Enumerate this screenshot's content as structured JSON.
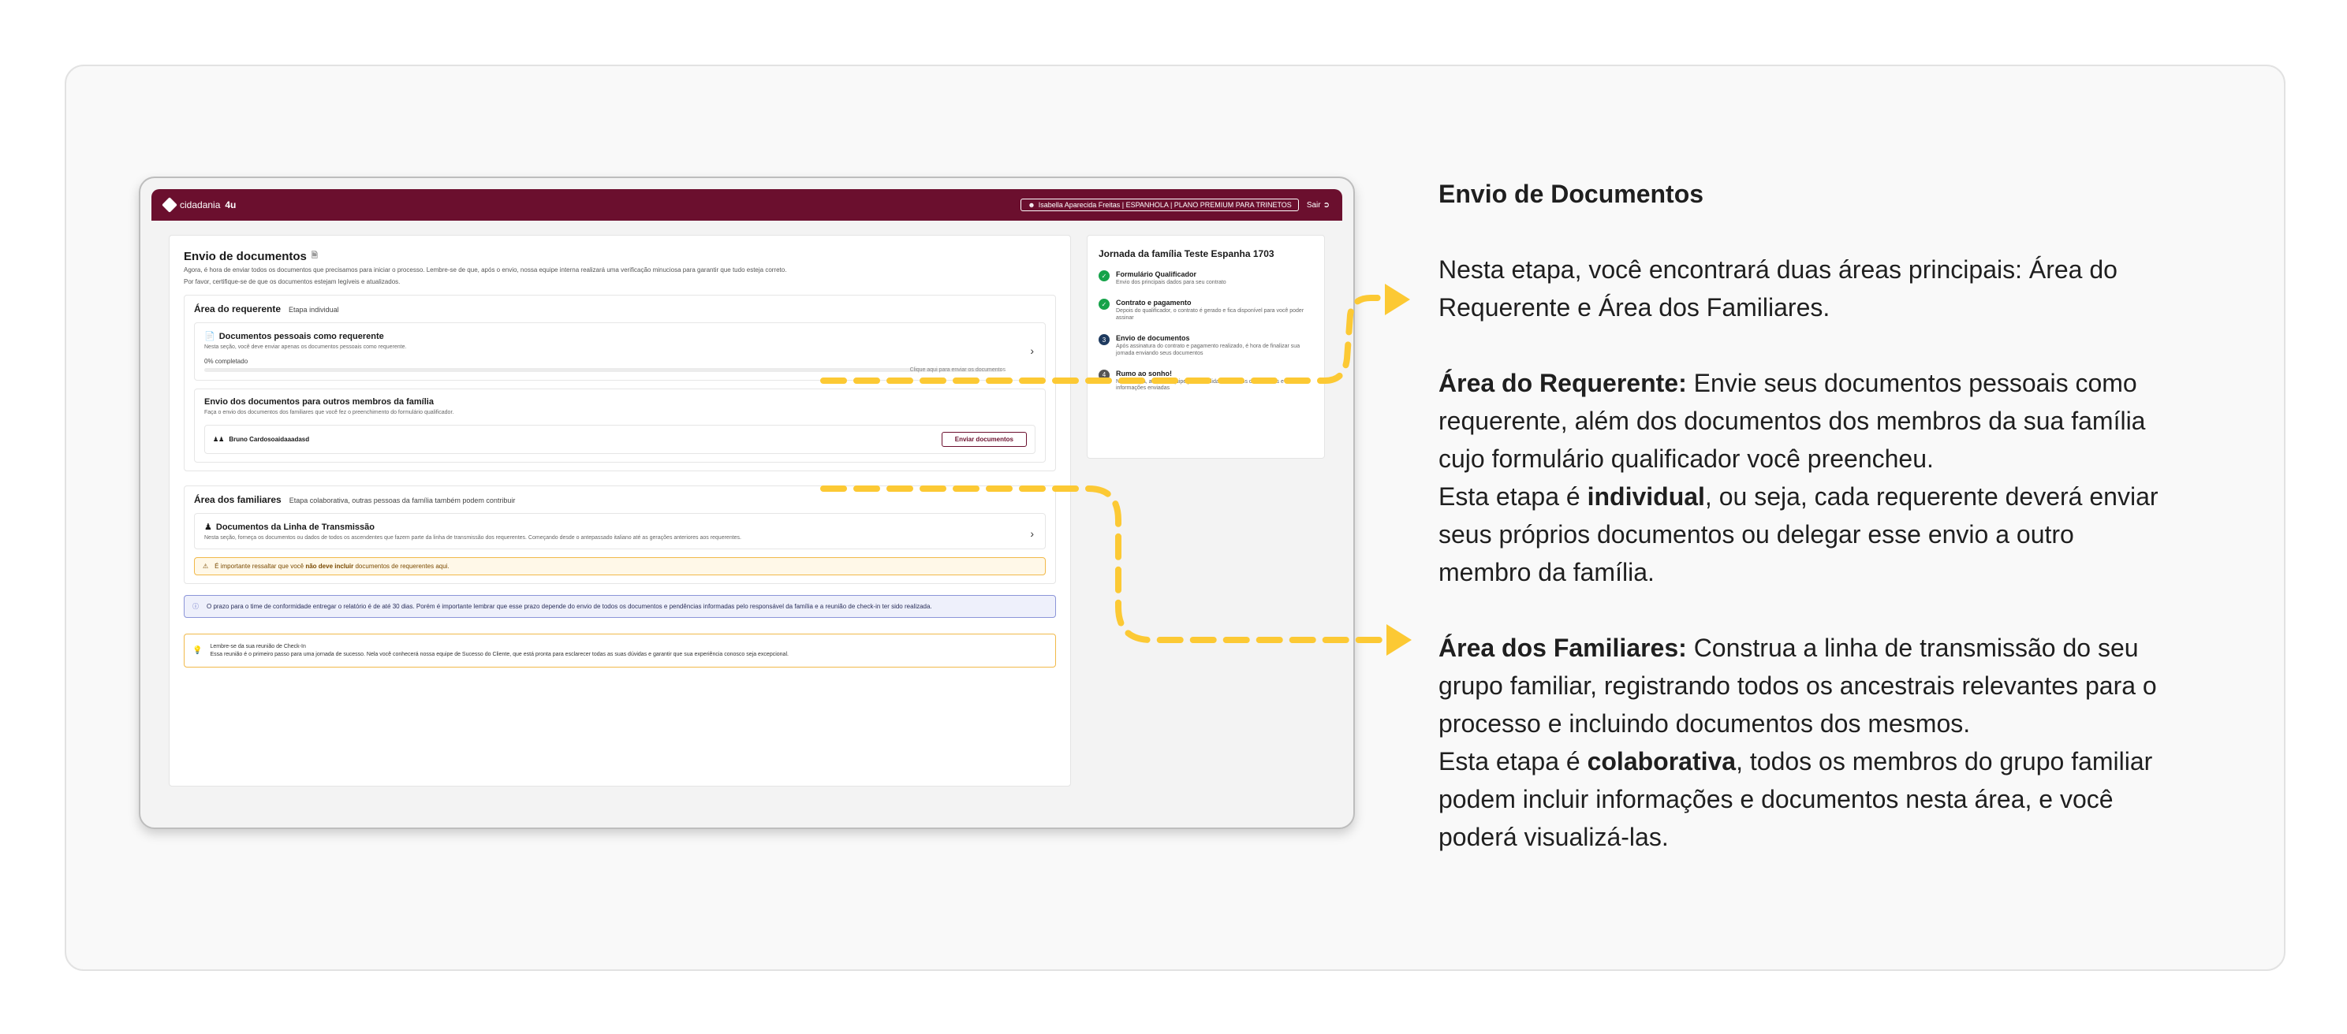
{
  "app": {
    "brand": "cidadania",
    "brand_suffix": "4u",
    "user_chip": "Isabella Aparecida Freitas  |  ESPANHOLA  |  PLANO PREMIUM PARA TRINETOS",
    "logout": "Sair"
  },
  "main": {
    "title": "Envio de documentos",
    "subtitle_1": "Agora, é hora de enviar todos os documentos que precisamos para iniciar o processo. Lembre-se de que, após o envio, nossa equipe interna realizará uma verificação minuciosa para garantir que tudo esteja correto.",
    "subtitle_2": "Por favor, certifique-se de que os documentos estejam legíveis e atualizados.",
    "requerente": {
      "heading": "Área do requerente",
      "tag": "Etapa individual",
      "personal_docs": {
        "title": "Documentos pessoais como requerente",
        "desc": "Nesta seção, você deve enviar apenas os documentos pessoais como requerente.",
        "progress_label": "0% completado",
        "progress_fraction": 0,
        "hint": "Clique aqui para enviar os documentos"
      },
      "family_docs": {
        "title": "Envio dos documentos para outros membros da família",
        "desc": "Faça o envio dos documentos dos familiares que você fez o preenchimento do formulário qualificador.",
        "member_name": "Bruno Cardosoaidaaadasd",
        "send_button": "Enviar documentos"
      }
    },
    "familiares": {
      "heading": "Área dos familiares",
      "tag": "Etapa colaborativa, outras pessoas da família também podem contribuir",
      "lineage": {
        "title": "Documentos da Linha de Transmissão",
        "desc": "Nesta seção, forneça os documentos ou dados de todos os ascendentes que fazem parte da linha de transmissão dos requerentes. Começando desde o antepassado italiano até as gerações anteriores aos requerentes."
      },
      "warning_pre": "É importante ressaltar que você ",
      "warning_bold": "não deve incluir",
      "warning_post": " documentos de requerentes aqui."
    },
    "info": "O prazo para o time de conformidade entregar o relatório é de até 30 dias. Porém é importante lembrar que esse prazo depende do envio de todos os documentos e pendências informadas pelo responsável da família e a reunião de check-in ter sido realizada.",
    "tip_title": "Lembre-se da sua reunião de Check-In",
    "tip_desc": "Essa reunião é o primeiro passo para uma jornada de sucesso. Nela você conhecerá nossa equipe de Sucesso do Cliente, que está pronta para esclarecer todas as suas dúvidas e garantir que sua experiência conosco seja excepcional."
  },
  "journey": {
    "title": "Jornada da família Teste Espanha 1703",
    "steps": [
      {
        "title": "Formulário Qualificador",
        "desc": "Envio dos principais dados para seu contrato",
        "state": "done"
      },
      {
        "title": "Contrato e pagamento",
        "desc": "Depois do qualificador, o contrato é gerado e fica disponível para você poder assinar",
        "state": "done"
      },
      {
        "title": "Envio de documentos",
        "desc": "Após assinatura do contrato e pagamento realizado, é hora de finalizar sua jornada enviando seus documentos",
        "state": "current",
        "num": "3"
      },
      {
        "title": "Rumo ao sonho!",
        "desc": "Nesta etapa, a nossa equipe já terá validado todos os documentos e informações enviadas",
        "state": "pending",
        "num": "4"
      }
    ]
  },
  "explain": {
    "title": "Envio de Documentos",
    "intro": "Nesta etapa, você encontrará duas áreas principais: Área do Requerente e Área dos Familiares.",
    "req_label": "Área do Requerente:",
    "req_text": " Envie seus documentos pessoais como requerente, além dos documentos dos membros da sua família cujo formulário qualificador você preencheu.",
    "req_line2_pre": "Esta etapa é ",
    "req_line2_bold": "individual",
    "req_line2_post": ", ou seja, cada requerente deverá enviar seus próprios documentos ou delegar esse envio a outro membro da família.",
    "fam_label": "Área dos Familiares:",
    "fam_text": " Construa a linha de transmissão do seu grupo familiar, registrando todos os ancestrais relevantes para o processo e incluindo documentos dos mesmos.",
    "fam_line2_pre": "Esta etapa é ",
    "fam_line2_bold": "colaborativa",
    "fam_line2_post": ", todos os membros do grupo familiar podem incluir informações e documentos nesta área, e você poderá visualizá-las."
  },
  "colors": {
    "brand": "#6b0f2e",
    "arrow": "#fcc934",
    "done": "#16a34a",
    "current": "#1e3a5f"
  }
}
